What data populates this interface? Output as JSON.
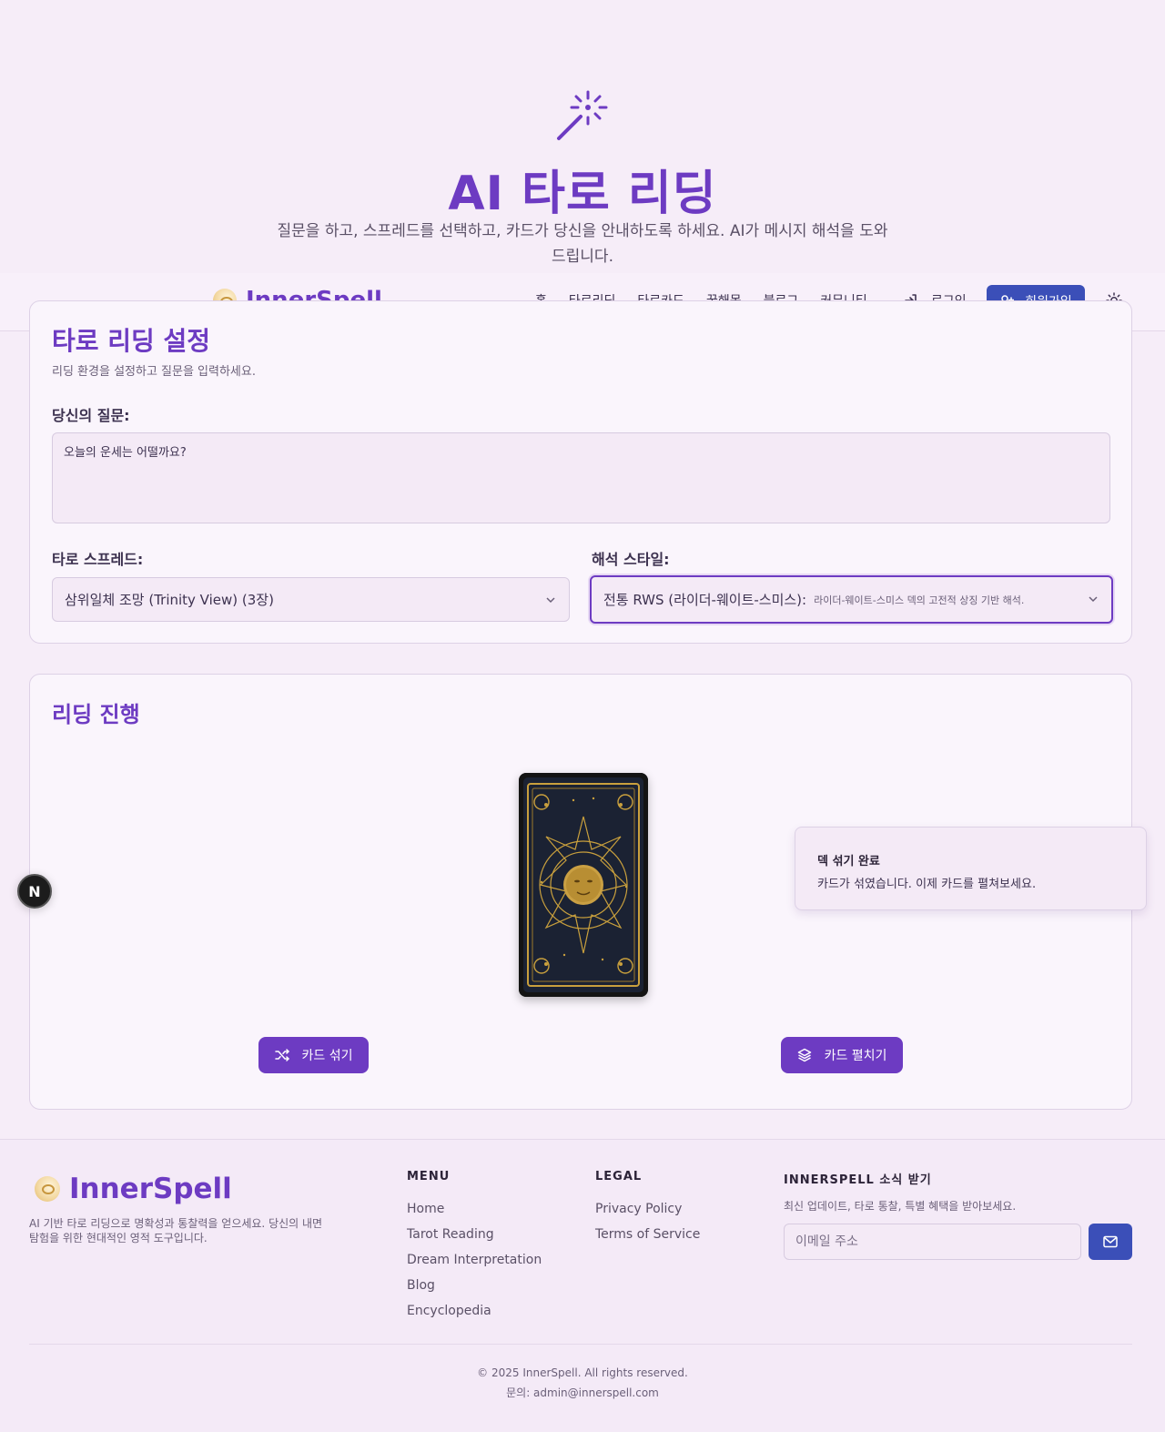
{
  "hero": {
    "title": "AI 타로 리딩",
    "subtitle": "질문을 하고, 스프레드를 선택하고, 카드가 당신을 안내하도록 하세요. AI가 메시지 해석을 도와드립니다.",
    "icon": "magic-wand-icon"
  },
  "header": {
    "brand": "InnerSpell",
    "nav": [
      "홈",
      "타로리딩",
      "타로카드",
      "꿈해몽",
      "블로그",
      "커뮤니티"
    ],
    "login_label": "로그인",
    "signup_label": "회원가입",
    "theme_icon": "sun-icon"
  },
  "settings": {
    "title": "타로 리딩 설정",
    "description": "리딩 환경을 설정하고 질문을 입력하세요.",
    "question_label": "당신의 질문:",
    "question_value": "오늘의 운세는 어떨까요?",
    "spread_label": "타로 스프레드:",
    "spread_value": "삼위일체 조망 (Trinity View) (3장)",
    "style_label": "해석 스타일:",
    "style_value": "전통 RWS (라이더-웨이트-스미스):",
    "style_desc": "라이더-웨이트-스미스 덱의 고전적 상징 기반 해석."
  },
  "reading": {
    "title": "리딩 진행",
    "shuffle_label": "카드 섞기",
    "spread_button_label": "카드 펼치기"
  },
  "toast": {
    "title": "덱 섞기 완료",
    "message": "카드가 섞였습니다. 이제 카드를 펼쳐보세요."
  },
  "badge": {
    "letter": "N"
  },
  "footer": {
    "brand": "InnerSpell",
    "description": "AI 기반 타로 리딩으로 명확성과 통찰력을 얻으세요. 당신의 내면 탐험을 위한 현대적인 영적 도구입니다.",
    "menu_heading": "MENU",
    "menu_links": [
      "Home",
      "Tarot Reading",
      "Dream Interpretation",
      "Blog",
      "Encyclopedia"
    ],
    "legal_heading": "LEGAL",
    "legal_links": [
      "Privacy Policy",
      "Terms of Service"
    ],
    "news_heading": "INNERSPELL 소식 받기",
    "news_desc": "최신 업데이트, 타로 통찰, 특별 혜택을 받아보세요.",
    "email_placeholder": "이메일 주소",
    "copyright": "© 2025 InnerSpell. All rights reserved.",
    "contact": "문의: admin@innerspell.com"
  },
  "colors": {
    "accent": "#6d3bc2",
    "primary_button": "#3b4fb8",
    "background": "#f6edf8"
  }
}
